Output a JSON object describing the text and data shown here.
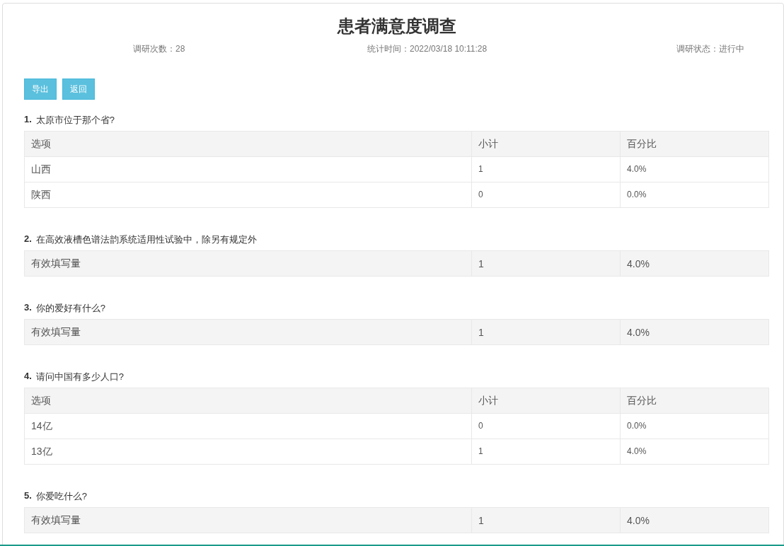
{
  "title": "患者满意度调查",
  "meta": [
    {
      "label": "调研次数：28"
    },
    {
      "label": "统计时间：2022/03/18 10:11:28"
    },
    {
      "label": "调研状态：进行中"
    }
  ],
  "buttons": [
    "导出",
    "返回"
  ],
  "questions": [
    {
      "number": "1.",
      "text": "太原市位于那个省?",
      "kind": "choice",
      "columns": [
        "选项",
        "小计",
        "百分比"
      ],
      "rows": [
        [
          "山西",
          "1",
          "4.0%"
        ],
        [
          "陕西",
          "0",
          "0.0%"
        ]
      ]
    },
    {
      "number": "2.",
      "text": "在高效液槽色谱法韵系统适用性试验中，除另有规定外",
      "kind": "fill",
      "rows": [
        [
          "有效填写量",
          "1",
          "4.0%"
        ]
      ]
    },
    {
      "number": "3.",
      "text": "你的爱好有什么?",
      "kind": "fill",
      "rows": [
        [
          "有效填写量",
          "1",
          "4.0%"
        ]
      ]
    },
    {
      "number": "4.",
      "text": "请问中国有多少人口?",
      "kind": "choice",
      "columns": [
        "选项",
        "小计",
        "百分比"
      ],
      "rows": [
        [
          "14亿",
          "0",
          "0.0%"
        ],
        [
          "13亿",
          "1",
          "4.0%"
        ]
      ]
    },
    {
      "number": "5.",
      "text": "你爱吃什么?",
      "kind": "fill",
      "rows": [
        [
          "有效填写量",
          "1",
          "4.0%"
        ]
      ]
    }
  ]
}
